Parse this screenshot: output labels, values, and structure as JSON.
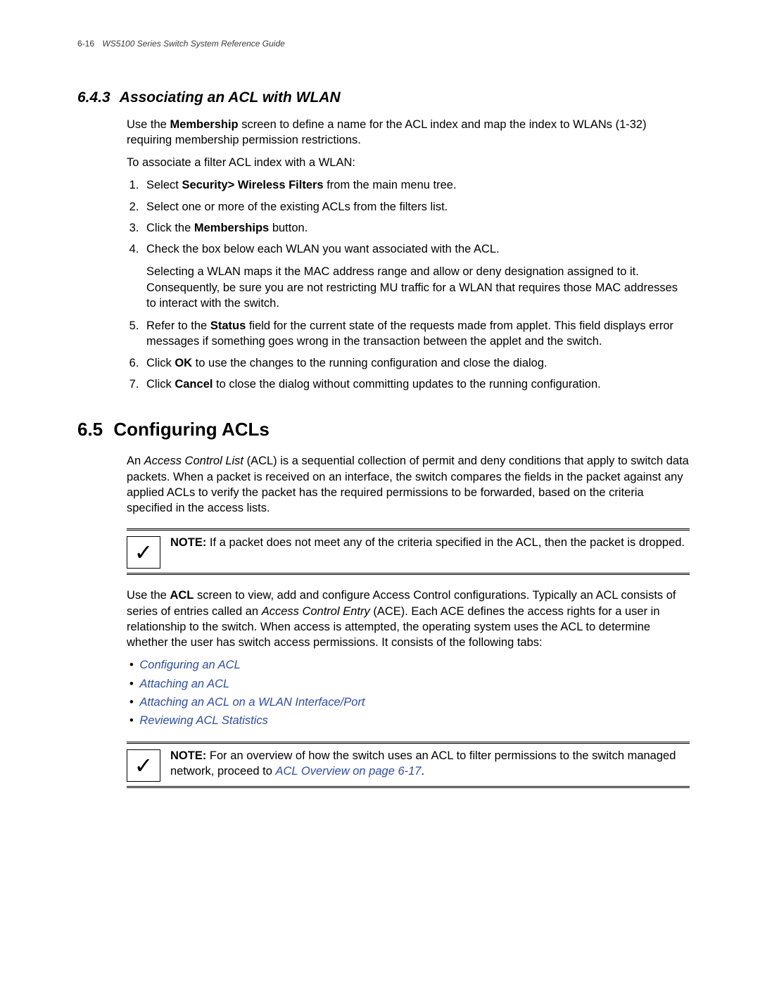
{
  "runhead": {
    "pageno": "6-16",
    "title": "WS5100 Series Switch System Reference Guide"
  },
  "s643": {
    "num": "6.4.3",
    "title": "Associating an ACL with WLAN",
    "intro_prefix": "Use the ",
    "intro_bold": "Membership",
    "intro_suffix": " screen to define a name for the ACL index and map the index to WLANs (1-32) requiring membership permission restrictions.",
    "assoc": "To associate a filter ACL index with a WLAN:",
    "step1_prefix": "Select ",
    "step1_bold": "Security> Wireless Filters",
    "step1_suffix": " from the main menu tree.",
    "step2": "Select one or more of the existing ACLs from the filters list.",
    "step3_prefix": "Click the ",
    "step3_bold": "Memberships",
    "step3_suffix": " button.",
    "step4": "Check the box below each WLAN you want associated with the ACL.",
    "step4_sub": "Selecting a WLAN maps it the MAC address range and allow or deny designation assigned to it. Consequently, be sure you are not restricting MU traffic for a WLAN that requires those MAC addresses to interact with the switch.",
    "step5_prefix": "Refer to the ",
    "step5_bold": "Status",
    "step5_suffix": " field for the current state of the requests made from applet. This field displays error messages if something goes wrong in the transaction between the applet and the switch.",
    "step6_prefix": "Click ",
    "step6_bold": "OK",
    "step6_suffix": " to use the changes to the running configuration and close the dialog.",
    "step7_prefix": "Click ",
    "step7_bold": "Cancel",
    "step7_suffix": " to close the dialog without committing updates to the running configuration."
  },
  "s65": {
    "num": "6.5",
    "title": "Configuring ACLs",
    "p1_prefix": "An ",
    "p1_em": "Access Control List",
    "p1_suffix": " (ACL) is a sequential collection of permit and deny conditions that apply to switch data packets. When a packet is received on an interface, the switch compares the fields in the packet against any applied ACLs to verify the packet has the required permissions to be forwarded, based on the criteria specified in the access lists.",
    "note1_label": "NOTE:",
    "note1_text": " If a packet does not meet any of the criteria specified in the ACL, then the packet is dropped.",
    "p2_prefix": "Use the ",
    "p2_bold": "ACL",
    "p2_mid": " screen to view, add and configure Access Control configurations. Typically an ACL consists of series of entries called an ",
    "p2_em": "Access Control Entry",
    "p2_suffix": " (ACE). Each ACE defines the access rights for a user in relationship to the switch. When access is attempted, the operating system uses the ACL to determine whether the user has switch access permissions. It consists of the following tabs:",
    "links": {
      "a": "Configuring an ACL",
      "b": "Attaching an ACL",
      "c": "Attaching an ACL on a WLAN Interface/Port",
      "d": "Reviewing ACL Statistics"
    },
    "note2_label": "NOTE:",
    "note2_text_prefix": " For an overview of how the switch uses an ACL to filter permissions to the switch managed network, proceed to ",
    "note2_link": "ACL Overview on page 6-17",
    "note2_text_suffix": "."
  },
  "icons": {
    "check": "✓"
  }
}
